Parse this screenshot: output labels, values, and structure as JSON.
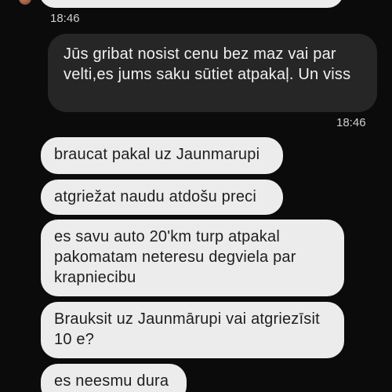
{
  "colors": {
    "background": "#0b0b0b",
    "incoming_bubble": "#ececec",
    "outgoing_bubble": "#262626",
    "timestamp": "#cfcfcf"
  },
  "messages": {
    "prev_incoming_time": "18:46",
    "outgoing_text": "Jūs gribat nosist cenu bez maz vai par velti,es jums saku sūtiet atpakaļ. Un viss",
    "outgoing_time": "18:46",
    "incoming": [
      "braucat pakal uz Jaunmarupi",
      "atgriežat naudu atdošu preci",
      "es savu auto 20'km turp atpakal pakomatam neteresu degviela par krapniecibu",
      "Brauksit uz Jaunmārupi vai atgriezīsit 10 e?",
      "es neesmu dura"
    ]
  }
}
